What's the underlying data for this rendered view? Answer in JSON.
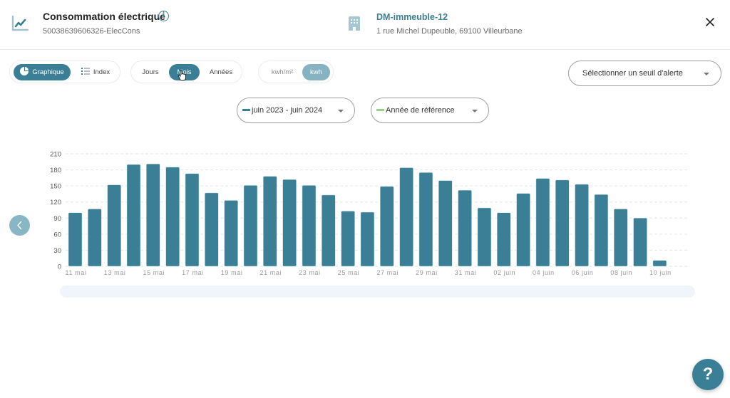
{
  "header": {
    "title": "Consommation électrique",
    "subtitle": "50038639606326-ElecCons",
    "info_icon": "info-icon",
    "chart_icon": "line-chart-icon",
    "building": {
      "icon": "building-icon",
      "name": "DM-immeuble-12",
      "address": "1 rue Michel Dupeuble, 69100 Villeurbane"
    },
    "close_icon": "close-icon"
  },
  "toolbar": {
    "view_toggle": [
      {
        "label": "Graphique",
        "icon": "pie-chart-icon",
        "active": true
      },
      {
        "label": "Index",
        "icon": "list-icon",
        "active": false
      }
    ],
    "period_toggle": [
      {
        "label": "Jours",
        "active": false
      },
      {
        "label": "Mois",
        "active": true
      },
      {
        "label": "Années",
        "active": false
      }
    ],
    "unit_toggle": [
      {
        "label": "kwh/m²",
        "active": false
      },
      {
        "label": "kwh",
        "active": true
      }
    ],
    "alert_select": {
      "placeholder": "Sélectionner un seuil d'alerte"
    }
  },
  "filters": {
    "period_select": {
      "label": "juin 2023 - juin 2024",
      "swatch_color": "#3a7f95"
    },
    "reference_select": {
      "label": "Année de référence",
      "swatch_color": "#9ccc8a"
    }
  },
  "colors": {
    "accent": "#3a7f95",
    "accent_light": "#85b3c1",
    "bar": "#3a7f95",
    "grid": "#e6e6e6",
    "axis_text": "#9a9a9a"
  },
  "help_button": {
    "label": "?"
  },
  "chart_data": {
    "type": "bar",
    "title": "",
    "xlabel": "",
    "ylabel": "",
    "ylim": [
      0,
      210
    ],
    "yticks": [
      0,
      30,
      60,
      90,
      120,
      150,
      180,
      210
    ],
    "grid": true,
    "categories": [
      "11 mai",
      "12 mai",
      "13 mai",
      "14 mai",
      "15 mai",
      "16 mai",
      "17 mai",
      "18 mai",
      "19 mai",
      "20 mai",
      "21 mai",
      "22 mai",
      "23 mai",
      "24 mai",
      "25 mai",
      "26 mai",
      "27 mai",
      "28 mai",
      "29 mai",
      "30 mai",
      "31 mai",
      "01 juin",
      "02 juin",
      "03 juin",
      "04 juin",
      "05 juin",
      "06 juin",
      "07 juin",
      "08 juin",
      "09 juin",
      "10 juin"
    ],
    "xtick_labels": [
      "11 mai",
      "",
      "13 mai",
      "",
      "15 mai",
      "",
      "17 mai",
      "",
      "19 mai",
      "",
      "21 mai",
      "",
      "23 mai",
      "",
      "25 mai",
      "",
      "27 mai",
      "",
      "29 mai",
      "",
      "31 mai",
      "",
      "02 juin",
      "",
      "04 juin",
      "",
      "06 juin",
      "",
      "08 juin",
      "",
      "10 juin"
    ],
    "series": [
      {
        "name": "juin 2023 - juin 2024",
        "values": [
          100,
          107,
          152,
          190,
          191,
          185,
          173,
          137,
          123,
          151,
          168,
          162,
          151,
          133,
          103,
          101,
          149,
          184,
          175,
          160,
          142,
          109,
          100,
          136,
          164,
          161,
          153,
          134,
          107,
          90,
          11
        ]
      }
    ]
  }
}
